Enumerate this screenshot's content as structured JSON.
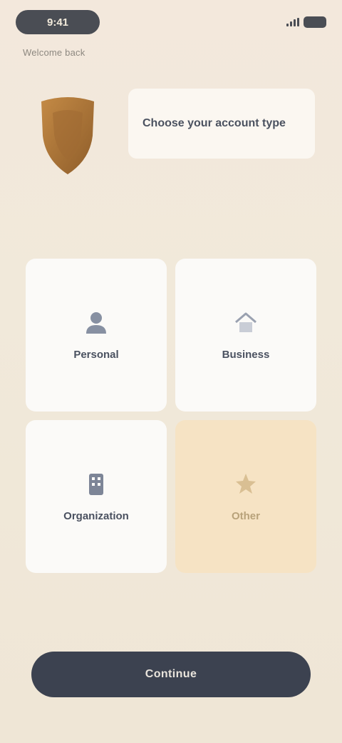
{
  "status_bar": {
    "time": "9:41",
    "icons": [
      "signal-icon",
      "battery-icon"
    ]
  },
  "header": {
    "caption": "Welcome back"
  },
  "brand": {
    "logo": "shield-crest-icon",
    "title": "Choose your account type"
  },
  "options": [
    {
      "label": "Personal",
      "icon": "person-icon",
      "selected": false
    },
    {
      "label": "Business",
      "icon": "house-icon",
      "selected": false
    },
    {
      "label": "Organization",
      "icon": "building-icon",
      "selected": false
    },
    {
      "label": "Other",
      "icon": "star-icon",
      "selected": true
    }
  ],
  "cta": {
    "label": "Continue"
  },
  "colors": {
    "background": "#f2eadb",
    "tile": "#fbfaf8",
    "tile_selected": "#f6e3c4",
    "cta": "#3c4250",
    "crest": "#b07b3c"
  }
}
